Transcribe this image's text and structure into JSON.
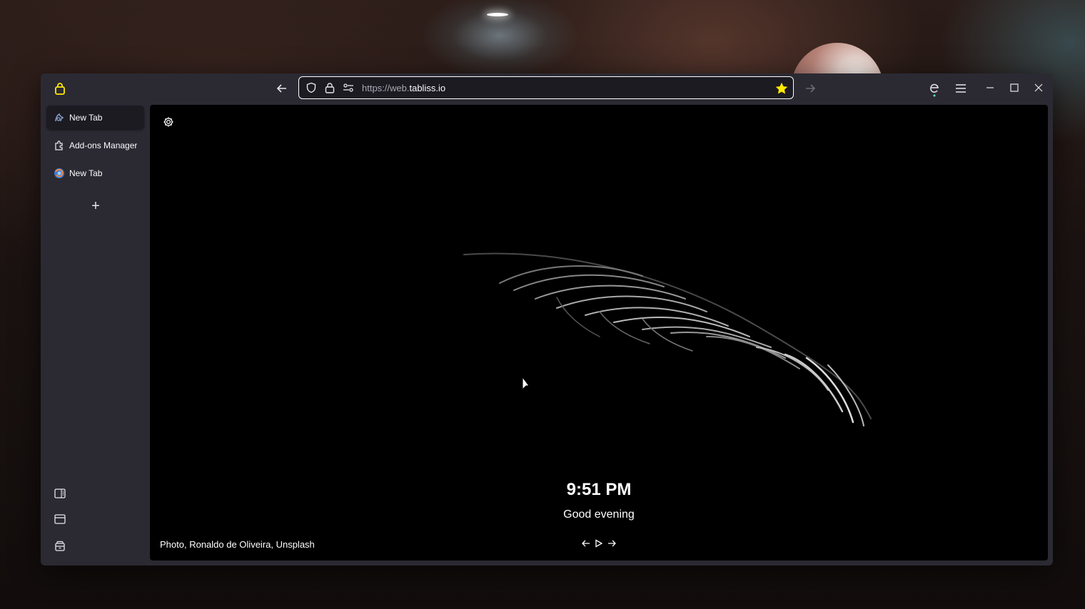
{
  "browser": {
    "url_prefix": "https://web.",
    "url_domain": "tabliss.io",
    "icons": {
      "private_lock": "lock-icon",
      "back": "arrow-left-icon",
      "tracking": "shield-icon",
      "connection": "lock-icon",
      "permissions": "permissions-icon",
      "bookmark": "star-filled-icon",
      "forward": "arrow-right-icon",
      "extensions": "extension-icon",
      "menu": "hamburger-menu-icon",
      "minimize": "minimize-icon",
      "maximize": "maximize-icon",
      "close": "close-icon"
    },
    "colors": {
      "bookmark_star": "#ffe900",
      "window_bg": "#2b2a33",
      "active_tab_bg": "#1c1b22"
    }
  },
  "sidebar": {
    "tabs": [
      {
        "label": "New Tab",
        "icon": "tabliss-icon",
        "active": true
      },
      {
        "label": "Add-ons Manager",
        "icon": "puzzle-icon",
        "active": false
      },
      {
        "label": "New Tab",
        "icon": "firefox-icon",
        "active": false
      }
    ],
    "new_tab_label": "+",
    "tools": [
      "sidebar-toggle-icon",
      "window-icon",
      "archive-icon"
    ]
  },
  "page": {
    "time": "9:51 PM",
    "greeting": "Good evening",
    "credit": "Photo, Ronaldo de Oliveira, Unsplash",
    "controls": [
      "arrow-left-icon",
      "play-icon",
      "arrow-right-icon"
    ]
  }
}
